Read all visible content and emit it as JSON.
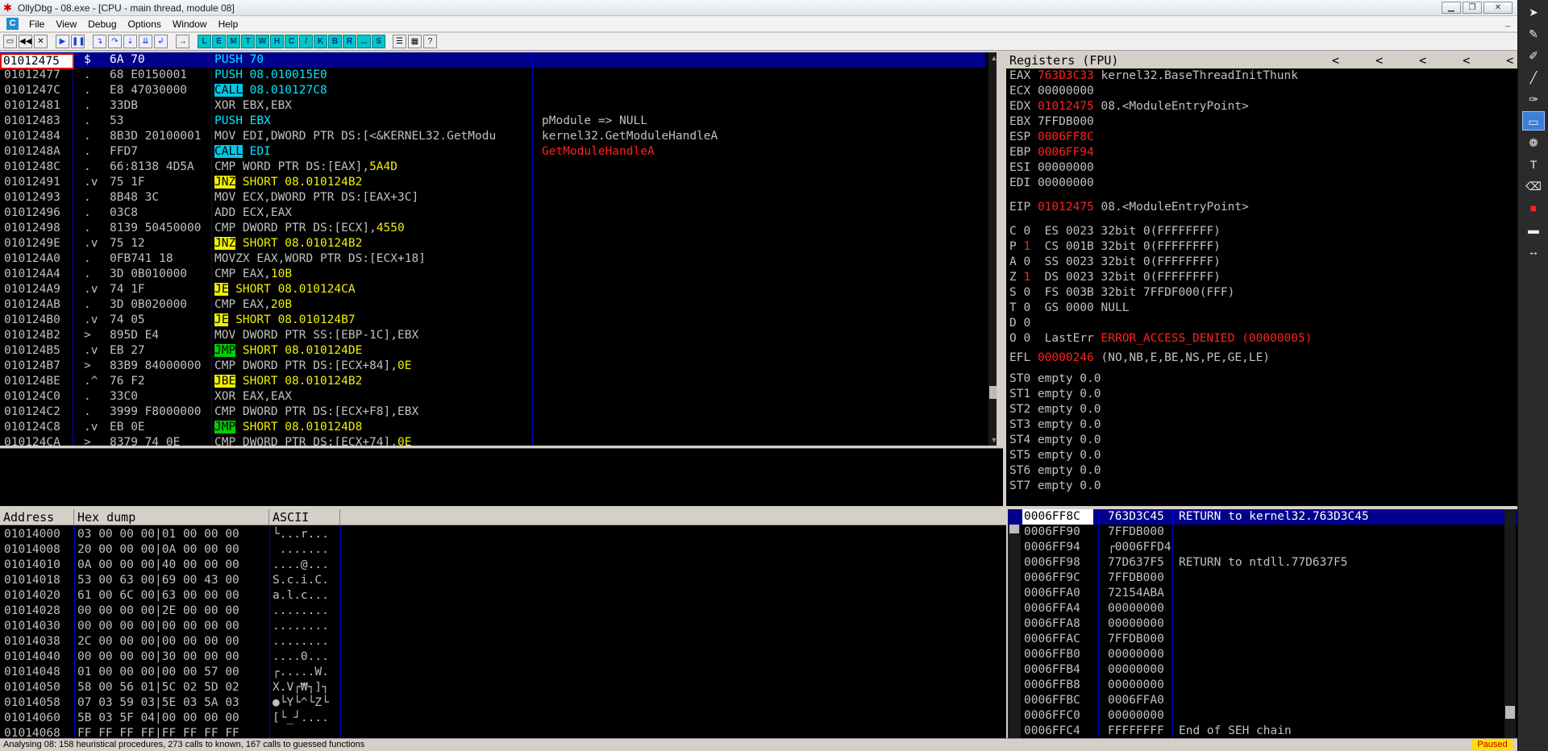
{
  "window": {
    "title": "OllyDbg - 08.exe - [CPU - main thread, module 08]"
  },
  "menu": [
    "File",
    "View",
    "Debug",
    "Options",
    "Window",
    "Help"
  ],
  "toolbar_letters": [
    "L",
    "E",
    "M",
    "T",
    "W",
    "H",
    "C",
    "/",
    "K",
    "B",
    "R",
    "...",
    "S"
  ],
  "disasm": {
    "selected_address": "01012475",
    "rows": [
      {
        "addr": "01012475",
        "mark": "$",
        "hex": "6A 70",
        "ins": "PUSH 70",
        "style": "push",
        "cmt": ""
      },
      {
        "addr": "01012477",
        "mark": ".",
        "hex": "68 E0150001",
        "ins": "PUSH 08.010015E0",
        "style": "push",
        "cmt": ""
      },
      {
        "addr": "0101247C",
        "mark": ".",
        "hex": "E8 47030000",
        "ins": "CALL 08.010127C8",
        "style": "call",
        "cmt": ""
      },
      {
        "addr": "01012481",
        "mark": ".",
        "hex": "33DB",
        "ins": "XOR EBX,EBX",
        "style": "plain",
        "cmt": ""
      },
      {
        "addr": "01012483",
        "mark": ".",
        "hex": "53",
        "ins": "PUSH EBX",
        "style": "push",
        "cmt": "pModule => NULL"
      },
      {
        "addr": "01012484",
        "mark": ".",
        "hex": "8B3D 20100001",
        "ins": "MOV EDI,DWORD PTR DS:[<&KERNEL32.GetModu",
        "style": "plain",
        "cmt": "kernel32.GetModuleHandleA"
      },
      {
        "addr": "0101248A",
        "mark": ".",
        "hex": "FFD7",
        "ins": "CALL EDI",
        "style": "call",
        "cmt": "GetModuleHandleA"
      },
      {
        "addr": "0101248C",
        "mark": ".",
        "hex": "66:8138 4D5A",
        "ins": "CMP WORD PTR DS:[EAX],5A4D",
        "style": "cmp",
        "cmt": ""
      },
      {
        "addr": "01012491",
        "mark": ".v",
        "hex": "75 1F",
        "ins": "JNZ SHORT 08.010124B2",
        "style": "jcc",
        "cmt": ""
      },
      {
        "addr": "01012493",
        "mark": ".",
        "hex": "8B48 3C",
        "ins": "MOV ECX,DWORD PTR DS:[EAX+3C]",
        "style": "plain",
        "cmt": ""
      },
      {
        "addr": "01012496",
        "mark": ".",
        "hex": "03C8",
        "ins": "ADD ECX,EAX",
        "style": "plain",
        "cmt": ""
      },
      {
        "addr": "01012498",
        "mark": ".",
        "hex": "8139 50450000",
        "ins": "CMP DWORD PTR DS:[ECX],4550",
        "style": "cmp",
        "cmt": ""
      },
      {
        "addr": "0101249E",
        "mark": ".v",
        "hex": "75 12",
        "ins": "JNZ SHORT 08.010124B2",
        "style": "jcc",
        "cmt": ""
      },
      {
        "addr": "010124A0",
        "mark": ".",
        "hex": "0FB741 18",
        "ins": "MOVZX EAX,WORD PTR DS:[ECX+18]",
        "style": "plain",
        "cmt": ""
      },
      {
        "addr": "010124A4",
        "mark": ".",
        "hex": "3D 0B010000",
        "ins": "CMP EAX,10B",
        "style": "cmp",
        "cmt": ""
      },
      {
        "addr": "010124A9",
        "mark": ".v",
        "hex": "74 1F",
        "ins": "JE SHORT 08.010124CA",
        "style": "jcc",
        "cmt": ""
      },
      {
        "addr": "010124AB",
        "mark": ".",
        "hex": "3D 0B020000",
        "ins": "CMP EAX,20B",
        "style": "cmp",
        "cmt": ""
      },
      {
        "addr": "010124B0",
        "mark": ".v",
        "hex": "74 05",
        "ins": "JE SHORT 08.010124B7",
        "style": "jcc",
        "cmt": ""
      },
      {
        "addr": "010124B2",
        "mark": ">",
        "hex": "895D E4",
        "ins": "MOV DWORD PTR SS:[EBP-1C],EBX",
        "style": "plain",
        "cmt": ""
      },
      {
        "addr": "010124B5",
        "mark": ".v",
        "hex": "EB 27",
        "ins": "JMP SHORT 08.010124DE",
        "style": "jmp",
        "cmt": ""
      },
      {
        "addr": "010124B7",
        "mark": ">",
        "hex": "83B9 84000000",
        "ins": "CMP DWORD PTR DS:[ECX+84],0E",
        "style": "cmp",
        "cmt": ""
      },
      {
        "addr": "010124BE",
        "mark": ".^",
        "hex": "76 F2",
        "ins": "JBE SHORT 08.010124B2",
        "style": "jcc",
        "cmt": ""
      },
      {
        "addr": "010124C0",
        "mark": ".",
        "hex": "33C0",
        "ins": "XOR EAX,EAX",
        "style": "plain",
        "cmt": ""
      },
      {
        "addr": "010124C2",
        "mark": ".",
        "hex": "3999 F8000000",
        "ins": "CMP DWORD PTR DS:[ECX+F8],EBX",
        "style": "plain",
        "cmt": ""
      },
      {
        "addr": "010124C8",
        "mark": ".v",
        "hex": "EB 0E",
        "ins": "JMP SHORT 08.010124D8",
        "style": "jmp",
        "cmt": ""
      },
      {
        "addr": "010124CA",
        "mark": ">",
        "hex": "8379 74 0E",
        "ins": "CMP DWORD PTR DS:[ECX+74],0E",
        "style": "cmp",
        "cmt": ""
      }
    ]
  },
  "registers": {
    "header": "Registers (FPU)",
    "arrows": [
      "<",
      "<",
      "<",
      "<",
      "<"
    ],
    "gp": [
      {
        "name": "EAX",
        "value": "763D3C33",
        "changed": true,
        "cmt": "kernel32.BaseThreadInitThunk"
      },
      {
        "name": "ECX",
        "value": "00000000",
        "changed": false,
        "cmt": ""
      },
      {
        "name": "EDX",
        "value": "01012475",
        "changed": true,
        "cmt": "08.<ModuleEntryPoint>"
      },
      {
        "name": "EBX",
        "value": "7FFDB000",
        "changed": false,
        "cmt": ""
      },
      {
        "name": "ESP",
        "value": "0006FF8C",
        "changed": true,
        "cmt": ""
      },
      {
        "name": "EBP",
        "value": "0006FF94",
        "changed": true,
        "cmt": ""
      },
      {
        "name": "ESI",
        "value": "00000000",
        "changed": false,
        "cmt": ""
      },
      {
        "name": "EDI",
        "value": "00000000",
        "changed": false,
        "cmt": ""
      }
    ],
    "eip": {
      "name": "EIP",
      "value": "01012475",
      "cmt": "08.<ModuleEntryPoint>"
    },
    "flags": [
      {
        "f": "C",
        "v": "0",
        "seg": "ES 0023 32bit 0(FFFFFFFF)"
      },
      {
        "f": "P",
        "v": "1",
        "seg": "CS 001B 32bit 0(FFFFFFFF)"
      },
      {
        "f": "A",
        "v": "0",
        "seg": "SS 0023 32bit 0(FFFFFFFF)"
      },
      {
        "f": "Z",
        "v": "1",
        "seg": "DS 0023 32bit 0(FFFFFFFF)"
      },
      {
        "f": "S",
        "v": "0",
        "seg": "FS 003B 32bit 7FFDF000(FFF)"
      },
      {
        "f": "T",
        "v": "0",
        "seg": "GS 0000 NULL"
      },
      {
        "f": "D",
        "v": "0",
        "seg": ""
      },
      {
        "f": "O",
        "v": "0",
        "seg": "LastErr"
      }
    ],
    "lasterr": "ERROR_ACCESS_DENIED (00000005)",
    "efl": {
      "name": "EFL",
      "value": "00000246",
      "cmt": "(NO,NB,E,BE,NS,PE,GE,LE)"
    },
    "fpu": [
      "ST0 empty 0.0",
      "ST1 empty 0.0",
      "ST2 empty 0.0",
      "ST3 empty 0.0",
      "ST4 empty 0.0",
      "ST5 empty 0.0",
      "ST6 empty 0.0",
      "ST7 empty 0.0"
    ]
  },
  "dump": {
    "headers": [
      "Address",
      "Hex dump",
      "ASCII"
    ],
    "rows": [
      {
        "a": "01014000",
        "h": "03 00 00 00|01 00 00 00",
        "s": "└...r..."
      },
      {
        "a": "01014008",
        "h": "20 00 00 00|0A 00 00 00",
        "s": " ......."
      },
      {
        "a": "01014010",
        "h": "0A 00 00 00|40 00 00 00",
        "s": "....@..."
      },
      {
        "a": "01014018",
        "h": "53 00 63 00|69 00 43 00",
        "s": "S.c.i.C."
      },
      {
        "a": "01014020",
        "h": "61 00 6C 00|63 00 00 00",
        "s": "a.l.c..."
      },
      {
        "a": "01014028",
        "h": "00 00 00 00|2E 00 00 00",
        "s": "........"
      },
      {
        "a": "01014030",
        "h": "00 00 00 00|00 00 00 00",
        "s": "........"
      },
      {
        "a": "01014038",
        "h": "2C 00 00 00|00 00 00 00",
        "s": "........"
      },
      {
        "a": "01014040",
        "h": "00 00 00 00|30 00 00 00",
        "s": "....0..."
      },
      {
        "a": "01014048",
        "h": "01 00 00 00|00 00 57 00",
        "s": "┌.....W."
      },
      {
        "a": "01014050",
        "h": "58 00 56 01|5C 02 5D 02",
        "s": "X.V┌₩┐]┐"
      },
      {
        "a": "01014058",
        "h": "07 03 59 03|5E 03 5A 03",
        "s": "●└Y└^└Z└"
      },
      {
        "a": "01014060",
        "h": "5B 03 5F 04|00 00 00 00",
        "s": "[└_┘...."
      },
      {
        "a": "01014068",
        "h": "FF FF FF FF|FF FF FF FF",
        "s": ""
      }
    ]
  },
  "stack": {
    "rows": [
      {
        "a": "0006FF8C",
        "v": "763D3C45",
        "c": "RETURN to kernel32.763D3C45"
      },
      {
        "a": "0006FF90",
        "v": "7FFDB000",
        "c": ""
      },
      {
        "a": "0006FF94",
        "v": "┌0006FFD4",
        "c": ""
      },
      {
        "a": "0006FF98",
        "v": "77D637F5",
        "c": "RETURN to ntdll.77D637F5"
      },
      {
        "a": "0006FF9C",
        "v": "7FFDB000",
        "c": ""
      },
      {
        "a": "0006FFA0",
        "v": "72154ABA",
        "c": ""
      },
      {
        "a": "0006FFA4",
        "v": "00000000",
        "c": ""
      },
      {
        "a": "0006FFA8",
        "v": "00000000",
        "c": ""
      },
      {
        "a": "0006FFAC",
        "v": "7FFDB000",
        "c": ""
      },
      {
        "a": "0006FFB0",
        "v": "00000000",
        "c": ""
      },
      {
        "a": "0006FFB4",
        "v": "00000000",
        "c": ""
      },
      {
        "a": "0006FFB8",
        "v": "00000000",
        "c": ""
      },
      {
        "a": "0006FFBC",
        "v": "0006FFA0",
        "c": ""
      },
      {
        "a": "0006FFC0",
        "v": "00000000",
        "c": ""
      },
      {
        "a": "0006FFC4",
        "v": "FFFFFFFF",
        "c": "End of SEH chain"
      }
    ]
  },
  "status": {
    "text": "Analysing 08: 158 heuristical procedures, 273 calls to known, 167 calls to guessed functions",
    "state": "Paused"
  },
  "colors": {
    "changed": "#ff2020",
    "selected_row": "#00008b",
    "call_bg": "#00c8e8",
    "jcc_bg": "#f0f000",
    "jmp_bg": "#00d000"
  }
}
